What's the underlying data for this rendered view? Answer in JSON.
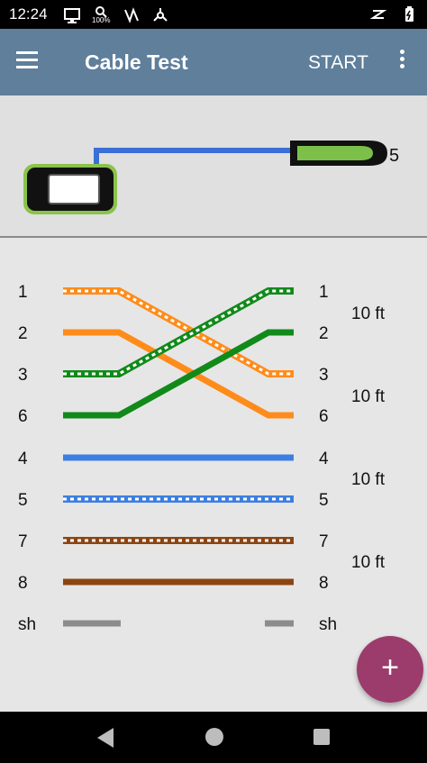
{
  "status_bar": {
    "time": "12:24",
    "icons": [
      "monitor-icon",
      "search-percent-icon",
      "vibrate-icon",
      "network-icon",
      "signal-icon",
      "battery-icon"
    ],
    "search_badge": "100%"
  },
  "app_bar": {
    "title": "Cable Test",
    "action": "START",
    "menu_icon": "hamburger-menu-icon",
    "overflow_icon": "more-vert-icon"
  },
  "cable_diagram": {
    "remote_id": "5",
    "colors": {
      "tester_body": "#111111",
      "tester_outline": "#8bc34a",
      "cable": "#3b6fd6",
      "remote_green": "#7cc04a"
    }
  },
  "wiremap": {
    "left_pins": [
      "1",
      "2",
      "3",
      "6",
      "4",
      "5",
      "7",
      "8",
      "sh"
    ],
    "right_pins": [
      "1",
      "2",
      "3",
      "6",
      "4",
      "5",
      "7",
      "8",
      "sh"
    ],
    "lengths": [
      "10 ft",
      "10 ft",
      "10 ft",
      "10 ft"
    ],
    "wire_colors": {
      "orange": "#ff8c1a",
      "green": "#118a1a",
      "blue": "#3d7fe0",
      "brown": "#8b4513",
      "shield": "#8c8c8c"
    }
  },
  "fab": {
    "label": "+"
  },
  "nav_bar": {
    "back": "back-icon",
    "home": "home-icon",
    "recents": "recents-icon"
  }
}
